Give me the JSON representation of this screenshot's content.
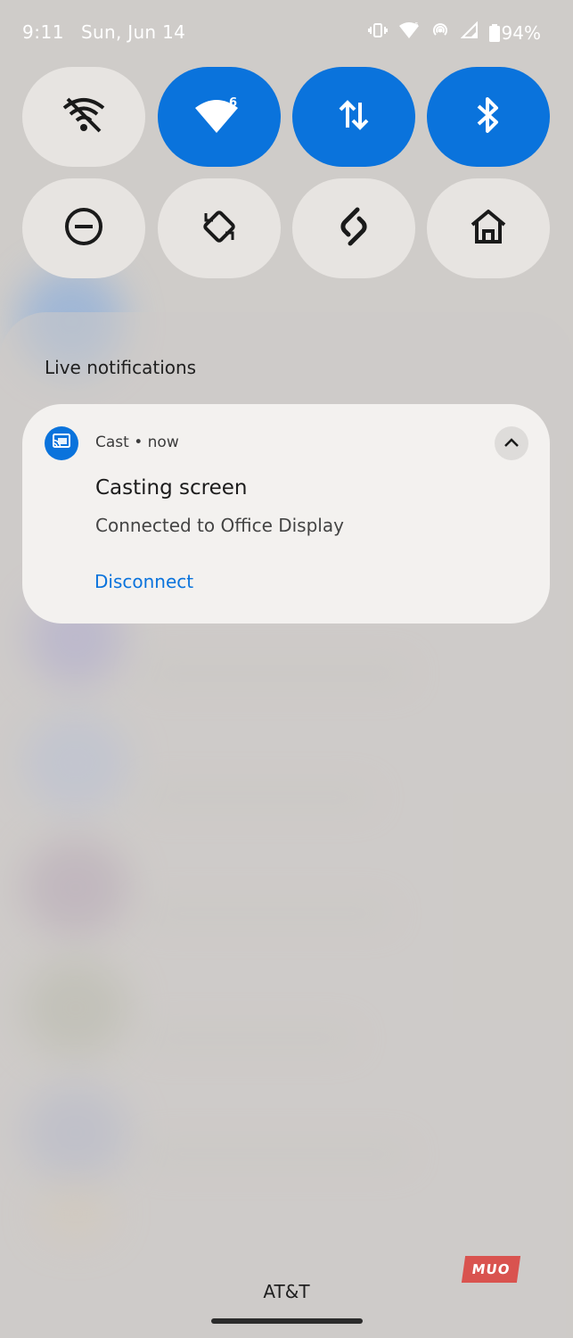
{
  "status_bar": {
    "time": "9:11",
    "date": "Sun, Jun 14",
    "battery": "94%",
    "icons": [
      "vibrate-icon",
      "wifi-icon",
      "hotspot-icon",
      "signal-icon",
      "battery-icon"
    ]
  },
  "quick_settings": {
    "tiles": [
      {
        "name": "wifi-off",
        "state": "off",
        "icon": "wifi-off-icon"
      },
      {
        "name": "wifi",
        "state": "on",
        "icon": "wifi-6-icon",
        "badge": "6"
      },
      {
        "name": "mobile-data",
        "state": "on",
        "icon": "data-arrows-icon"
      },
      {
        "name": "bluetooth",
        "state": "on",
        "icon": "bluetooth-icon"
      },
      {
        "name": "do-not-disturb",
        "state": "off",
        "icon": "dnd-icon"
      },
      {
        "name": "auto-rotate",
        "state": "off",
        "icon": "rotate-icon"
      },
      {
        "name": "shazam",
        "state": "off",
        "icon": "shazam-icon"
      },
      {
        "name": "home",
        "state": "off",
        "icon": "home-icon"
      }
    ]
  },
  "shade": {
    "section_title": "Live notifications"
  },
  "notification": {
    "app": "Cast",
    "time": "now",
    "separator": "•",
    "title": "Casting screen",
    "text": "Connected to Office Display",
    "action": "Disconnect"
  },
  "footer": {
    "carrier": "AT&T",
    "watermark": "MUO"
  },
  "colors": {
    "accent": "#0a73dc",
    "tile_off": "#e7e4e1",
    "card": "#f3f1ef"
  }
}
